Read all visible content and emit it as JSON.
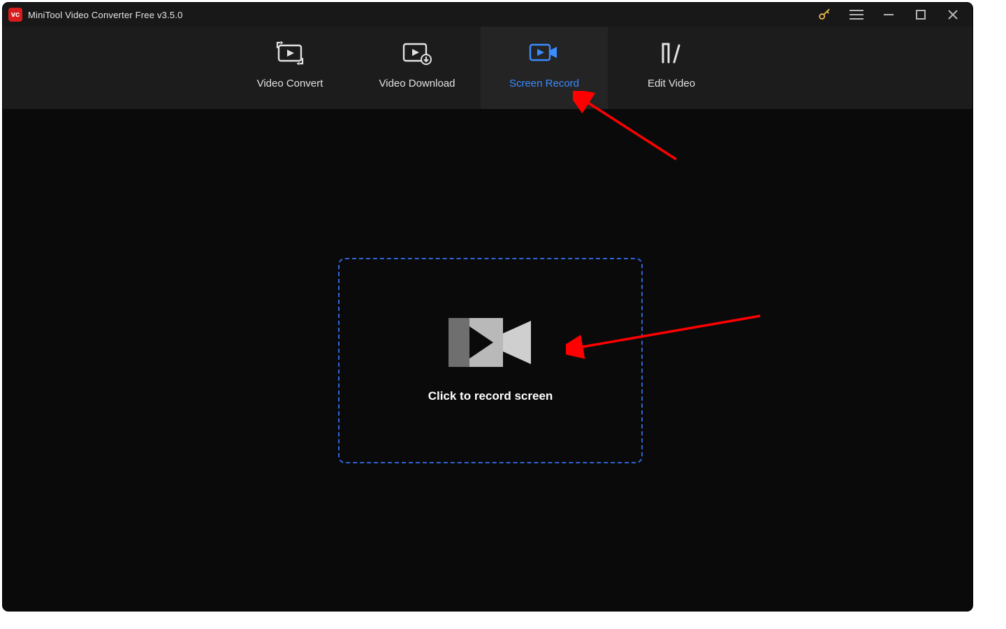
{
  "titlebar": {
    "app_logo_text": "vc",
    "title": "MiniTool Video Converter Free v3.5.0"
  },
  "tabs": {
    "convert": {
      "label": "Video Convert"
    },
    "download": {
      "label": "Video Download"
    },
    "record": {
      "label": "Screen Record"
    },
    "edit": {
      "label": "Edit Video"
    },
    "active": "record"
  },
  "main": {
    "record_prompt": "Click to record screen"
  },
  "colors": {
    "accent": "#3b8cff",
    "dash_border": "#2e66d6",
    "logo_bg": "#d91c1c",
    "key": "#f2c14e"
  }
}
